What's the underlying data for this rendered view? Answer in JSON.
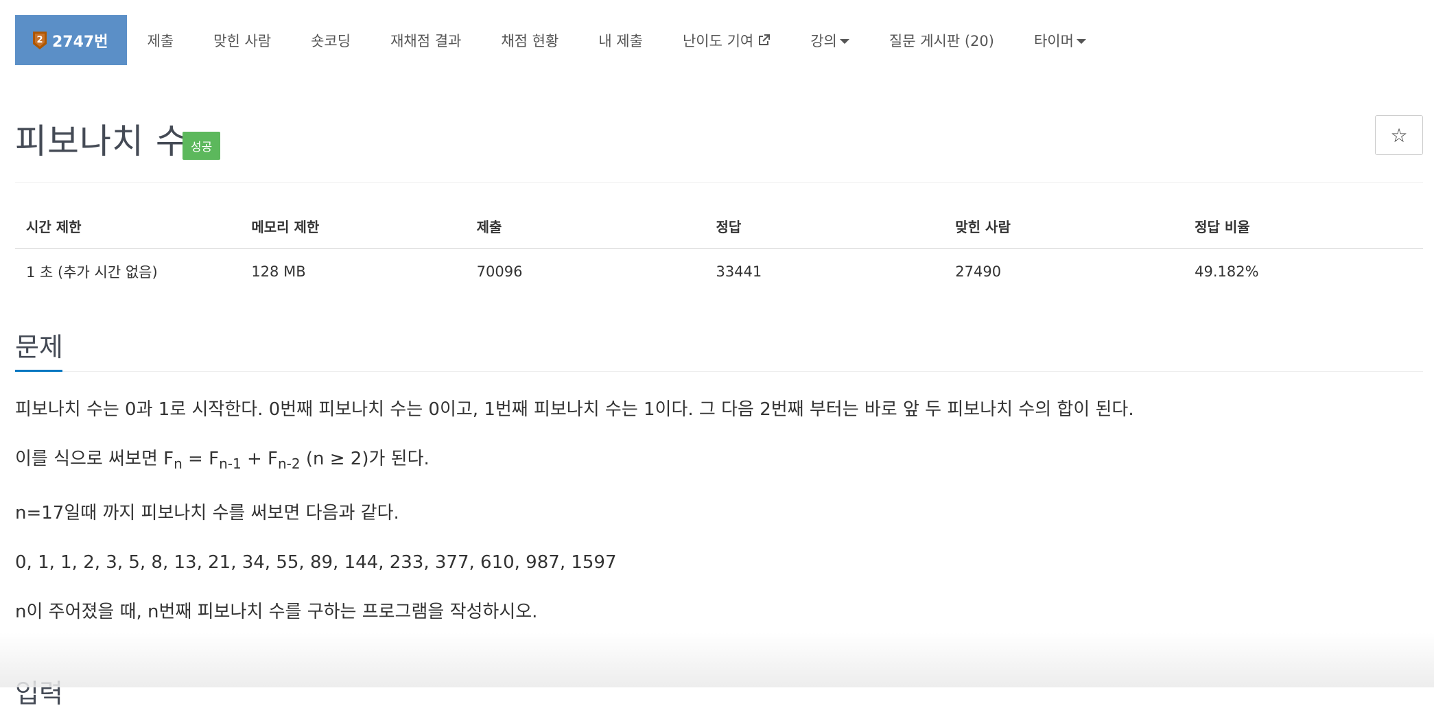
{
  "nav": {
    "brand": "2747번",
    "items": [
      {
        "label": "제출"
      },
      {
        "label": "맞힌 사람"
      },
      {
        "label": "숏코딩"
      },
      {
        "label": "재채점 결과"
      },
      {
        "label": "채점 현황"
      },
      {
        "label": "내 제출"
      },
      {
        "label": "난이도 기여",
        "icon": "external-link-icon"
      },
      {
        "label": "강의",
        "icon": "caret-down-icon"
      },
      {
        "label": "질문 게시판 (20)"
      },
      {
        "label": "타이머",
        "icon": "caret-down-icon"
      }
    ]
  },
  "problem": {
    "title": "피보나치 수",
    "badge": "성공",
    "star_icon": "☆"
  },
  "info": {
    "headers": [
      "시간 제한",
      "메모리 제한",
      "제출",
      "정답",
      "맞힌 사람",
      "정답 비율"
    ],
    "values": [
      "1 초 (추가 시간 없음)",
      "128 MB",
      "70096",
      "33441",
      "27490",
      "49.182%"
    ]
  },
  "sections": {
    "problem_title": "문제",
    "input_title": "입력"
  },
  "body": {
    "p1": "피보나치 수는 0과 1로 시작한다. 0번째 피보나치 수는 0이고, 1번째 피보나치 수는 1이다. 그 다음 2번째 부터는 바로 앞 두 피보나치 수의 합이 된다.",
    "p2_prefix": "이를 식으로 써보면 F",
    "p2_sub1": "n",
    "p2_mid1": " = F",
    "p2_sub2": "n-1",
    "p2_mid2": " + F",
    "p2_sub3": "n-2",
    "p2_suffix": " (n ≥ 2)가 된다.",
    "p3": "n=17일때 까지 피보나치 수를 써보면 다음과 같다.",
    "p4": "0, 1, 1, 2, 3, 5, 8, 13, 21, 34, 55, 89, 144, 233, 377, 610, 987, 1597",
    "p5": "n이 주어졌을 때, n번째 피보나치 수를 구하는 프로그램을 작성하시오."
  },
  "colors": {
    "brand": "#5b8fc7",
    "badge": "#5cb85c",
    "underline": "#0076c0"
  }
}
